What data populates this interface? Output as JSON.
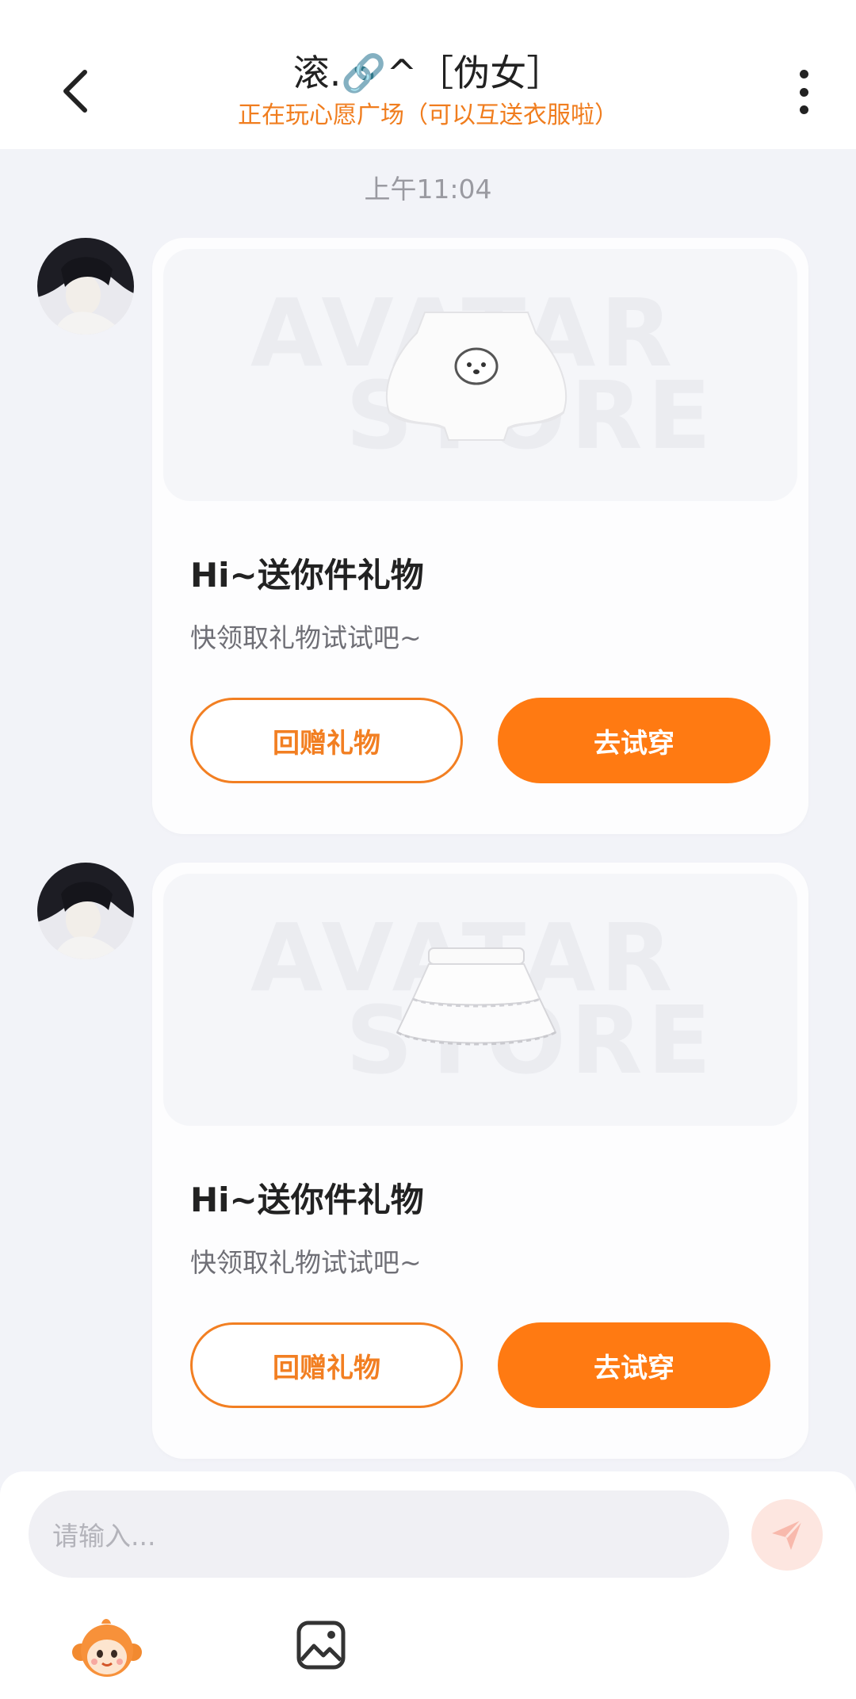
{
  "header": {
    "title": "滚.🔗^［伪女］",
    "subtitle": "正在玩心愿广场（可以互送衣服啦）"
  },
  "chat": {
    "timestamp": "上午11:04",
    "messages": [
      {
        "item": "white top with puppy print",
        "watermark_line1": "AVATAR",
        "watermark_line2": "STORE",
        "heading": "Hi~送你件礼物",
        "desc": "快领取礼物试试吧~",
        "return_label": "回赠礼物",
        "tryon_label": "去试穿"
      },
      {
        "item": "white tiered lace skirt",
        "watermark_line1": "AVATAR",
        "watermark_line2": "STORE",
        "heading": "Hi~送你件礼物",
        "desc": "快领取礼物试试吧~",
        "return_label": "回赠礼物",
        "tryon_label": "去试穿"
      }
    ]
  },
  "composer": {
    "placeholder": "请输入..."
  },
  "colors": {
    "accent": "#ff7a12",
    "background": "#f2f3f8"
  },
  "icons": [
    "back-arrow-icon",
    "more-vertical-icon",
    "send-icon",
    "mascot-emoji-icon",
    "image-icon"
  ]
}
